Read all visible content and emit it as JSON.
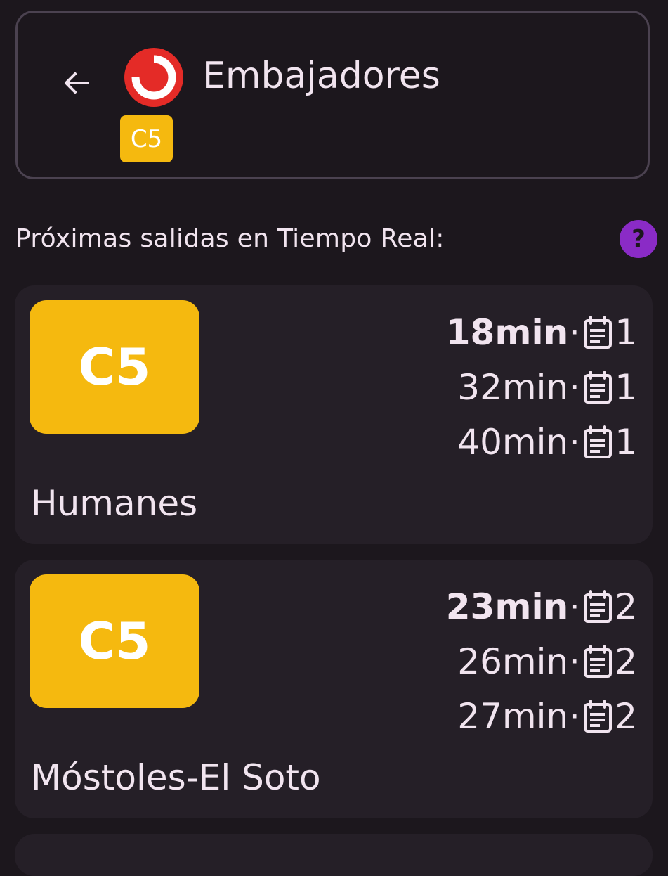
{
  "header": {
    "station_name": "Embajadores",
    "line_badge": "C5",
    "line_color": "#f5b90f",
    "logo_color": "#e42b27"
  },
  "section": {
    "title": "Próximas salidas en Tiempo Real:",
    "help_symbol": "?"
  },
  "departures": [
    {
      "line": "C5",
      "destination": "Humanes",
      "times": [
        {
          "time": "18min",
          "track": "1"
        },
        {
          "time": "32min",
          "track": "1"
        },
        {
          "time": "40min",
          "track": "1"
        }
      ]
    },
    {
      "line": "C5",
      "destination": "Móstoles-El Soto",
      "times": [
        {
          "time": "23min",
          "track": "2"
        },
        {
          "time": "26min",
          "track": "2"
        },
        {
          "time": "27min",
          "track": "2"
        }
      ]
    }
  ],
  "separator": "·",
  "icons": {
    "back": "arrow-left-icon",
    "logo": "renfe-cercanias-logo",
    "help": "help-icon",
    "track": "calendar-icon"
  }
}
